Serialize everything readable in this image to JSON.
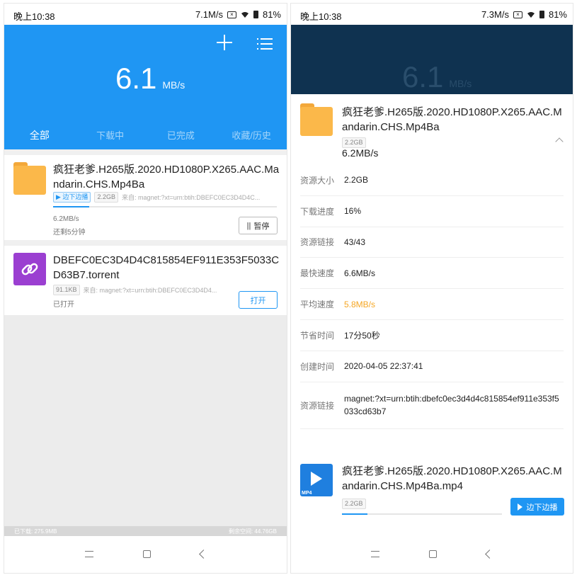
{
  "left": {
    "status": {
      "time": "晚上10:38",
      "speed": "7.1M/s",
      "battery": "81%"
    },
    "header": {
      "speed_value": "6.1",
      "speed_unit": "MB/s",
      "add_icon": "plus-icon",
      "menu_icon": "list-icon",
      "bg": "#1f96f3"
    },
    "tabs": [
      "全部",
      "下载中",
      "已完成",
      "收藏/历史"
    ],
    "tasks": [
      {
        "title": "疯狂老爹.H265版.2020.HD1080P.X265.AAC.Mandarin.CHS.Mp4Ba",
        "badge": "边下边播",
        "size": "2.2GB",
        "source": "来自: magnet:?xt=urn:btih:DBEFC0EC3D4D4C...",
        "progress": 0.16,
        "speed": "6.2MB/s",
        "remaining": "还剩5分钟",
        "action": "暂停"
      },
      {
        "title": "DBEFC0EC3D4D4C815854EF911E353F5033CD63B7.torrent",
        "size": "91.1KB",
        "source": "来自: magnet:?xt=urn:btih:DBEFC0EC3D4D4...",
        "status": "已打开",
        "action": "打开"
      }
    ],
    "footer": {
      "downloaded": "已下载: 275.9MB",
      "free": "剩余空间: 44.76GB"
    }
  },
  "right": {
    "status": {
      "time": "晚上10:38",
      "speed": "7.3M/s",
      "battery": "81%"
    },
    "header": {
      "speed_value": "6.1",
      "speed_unit": "MB/s",
      "bg": "#0f3250"
    },
    "task": {
      "title": "疯狂老爹.H265版.2020.HD1080P.X265.AAC.Mandarin.CHS.Mp4Ba",
      "size": "2.2GB",
      "speed": "6.2MB/s"
    },
    "details": [
      {
        "key": "资源大小",
        "value": "2.2GB"
      },
      {
        "key": "下载进度",
        "value": "16%"
      },
      {
        "key": "资源链接",
        "value": "43/43"
      },
      {
        "key": "最快速度",
        "value": "6.6MB/s"
      },
      {
        "key": "平均速度",
        "value": "5.8MB/s",
        "highlight": "#f5a623"
      },
      {
        "key": "节省时间",
        "value": "17分50秒"
      },
      {
        "key": "创建时间",
        "value": "2020-04-05 22:37:41"
      },
      {
        "key": "资源链接",
        "value": "magnet:?xt=urn:btih:dbefc0ec3d4d4c815854ef911e353f5033cd63b7"
      }
    ],
    "file": {
      "title": "疯狂老爹.H265版.2020.HD1080P.X265.AAC.Mandarin.CHS.Mp4Ba.mp4",
      "type_label": "MP4",
      "size": "2.2GB",
      "progress": 0.16,
      "action": "边下边播"
    }
  }
}
